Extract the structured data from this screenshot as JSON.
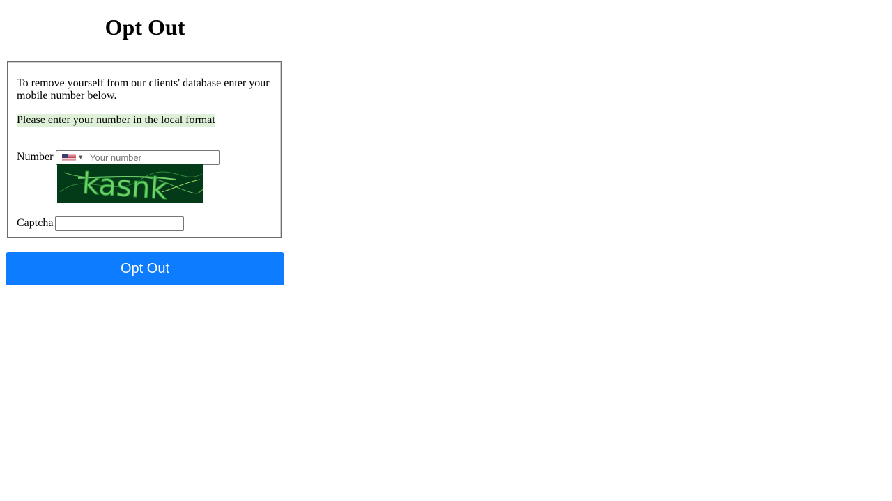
{
  "page": {
    "title": "Opt Out"
  },
  "form": {
    "intro": "To remove yourself from our clients' database enter your mobile number below.",
    "hint": "Please enter your number in the local format",
    "number_label": "Number",
    "number_placeholder": "Your number",
    "number_value": "",
    "country_flag": "us-flag-icon",
    "captcha_label": "Captcha",
    "captcha_text": "kasnk",
    "captcha_value": "",
    "submit_label": "Opt Out"
  },
  "colors": {
    "button_bg": "#0d7cff",
    "hint_bg": "#dff0d8",
    "captcha_bg": "#033a18",
    "captcha_fg": "#6fd36a"
  }
}
